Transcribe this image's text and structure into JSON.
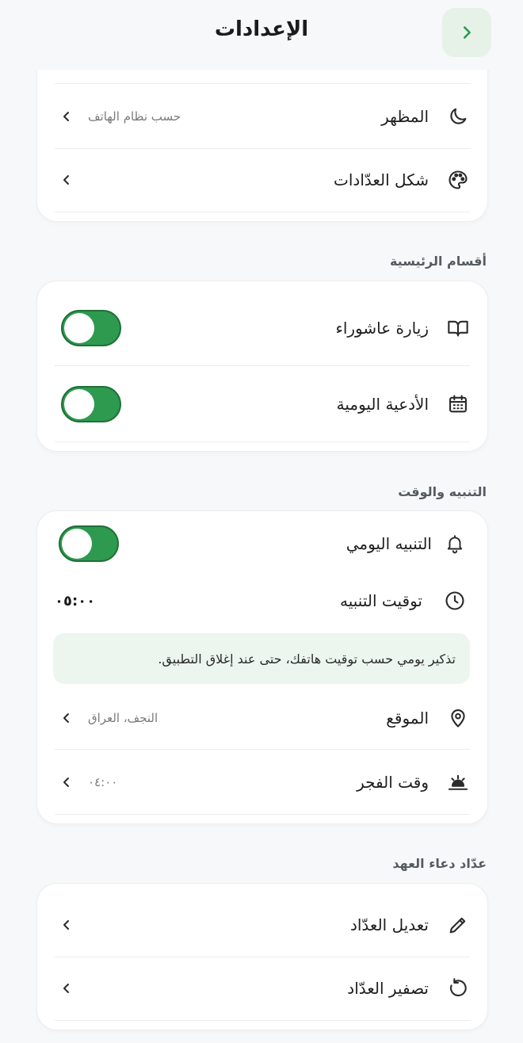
{
  "header": {
    "title": "الإعدادات"
  },
  "appearance_card": {
    "appearance": {
      "label": "المظهر",
      "value": "حسب نظام الهاتف"
    },
    "counter_style": {
      "label": "شكل العدّادات"
    }
  },
  "main_sections": {
    "title": "أقسام الرئيسية",
    "items": [
      {
        "label": "زيارة عاشوراء",
        "enabled": true
      },
      {
        "label": "الأدعية اليومية",
        "enabled": true
      }
    ]
  },
  "alerts": {
    "title": "التنبيه والوقت",
    "daily_alert": {
      "label": "التنبيه اليومي",
      "enabled": true
    },
    "alert_time": {
      "label": "توقيت التنبيه",
      "value": "٠٥:٠٠"
    },
    "info": "تذكير يومي حسب توقيت هاتفك، حتى عند إغلاق التطبيق.",
    "location": {
      "label": "الموقع",
      "value": "النجف، العراق"
    },
    "fajr": {
      "label": "وقت الفجر",
      "value": "٠٤:٠٠"
    }
  },
  "counter": {
    "title": "عدّاد دعاء العهد",
    "edit_label": "تعديل العدّاد",
    "reset_label": "تصفير العدّاد"
  },
  "colors": {
    "accent": "#2e9a4f",
    "accent_light": "#e6f2e8"
  }
}
